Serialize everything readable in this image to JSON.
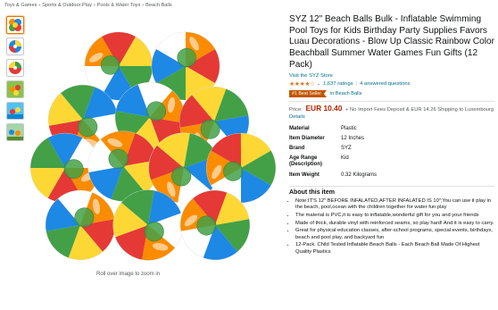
{
  "breadcrumb": [
    "Toys & Games",
    "Sports & Outdoor Play",
    "Pools & Water Toys",
    "Beach Balls"
  ],
  "breadcrumb_separator": "›",
  "product": {
    "title": "SYZ 12\" Beach Balls Bulk - Inflatable Swimming Pool Toys for Kids Birthday Party Supplies Favors Luau Decorations - Blow Up Classic Rainbow Color Beachball Summer Water Games Fun Gifts (12 Pack)",
    "store_link": "Visit the SYZ Store",
    "rating_stars": "★★★★☆",
    "rating_chevron": "⌄",
    "ratings_count": "1,637 ratings",
    "answered": "4 answered questions",
    "separator": "|",
    "best_seller_badge": "#1 Best Seller",
    "best_seller_category": "in Beach Balls",
    "price_label": "Price:",
    "price": "EUR 10.40",
    "fees": "+ No Import Fees Deposit & EUR 14.26 Shipping to Luxembourg",
    "details_link": "Details"
  },
  "specs": [
    {
      "key": "Material",
      "value": "Plastic"
    },
    {
      "key": "Item Diameter",
      "value": "12 Inches"
    },
    {
      "key": "Brand",
      "value": "SYZ"
    },
    {
      "key": "Age Range (Description)",
      "value": "Kid"
    },
    {
      "key": "Item Weight",
      "value": "0.32 Kilograms"
    }
  ],
  "about": {
    "title": "About this item",
    "bullets": [
      "Note:IT'S 12\" BEFORE INFALATED,AFTER INFALATED IS 10\";You can use it play in the beach, pool,ocean with the children together for water fun play",
      "The material is PVC,it is easy to inflatable,wonderful gift for you and your friends",
      "Made of thick, durable vinyl with reinforced seams, so play hard! And it is easy to carry.",
      "Great for physical education classes, after-school programs, special events, birthdays, beach and pool play, and backyard fun",
      "12-Pack. Child Tested Inflatable Beach Balls - Each Beach Ball Made Of Highest Quality Plastics"
    ]
  },
  "image": {
    "zoom_hint": "Roll over image to zoom in",
    "thumbnail_count": 6,
    "ball_colors": [
      "#e53935",
      "#fb8c00",
      "#fdd835",
      "#43a047",
      "#1e88e5",
      "#ffffff"
    ]
  },
  "colors": {
    "link": "#007185",
    "price": "#b12704",
    "best_seller": "#c45500",
    "stars": "#de7921"
  }
}
